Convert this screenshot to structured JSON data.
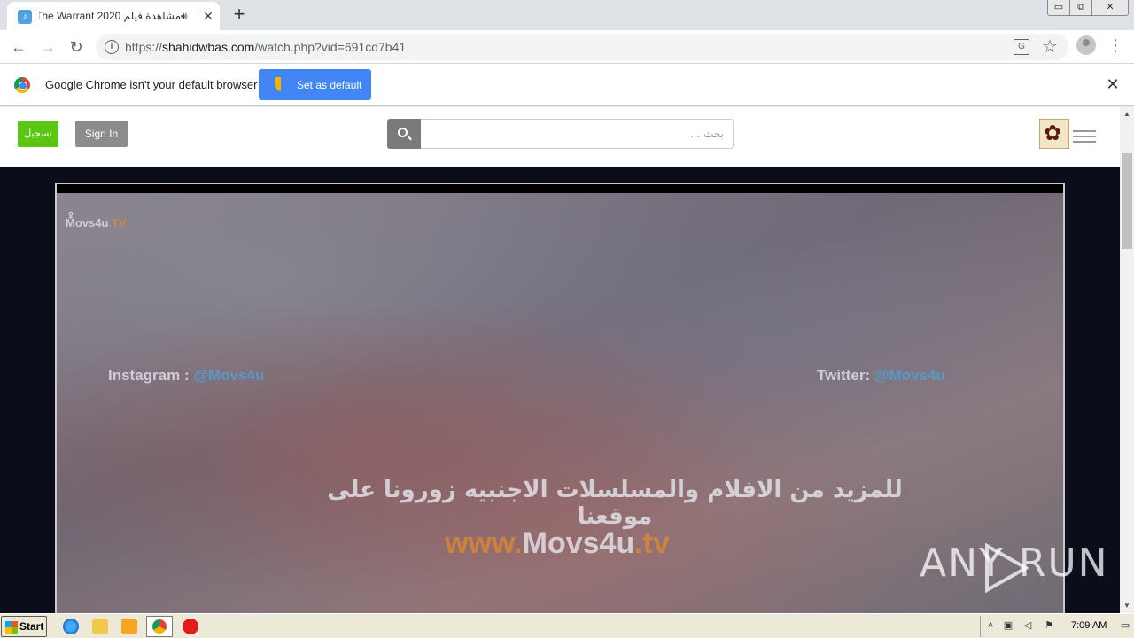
{
  "browser": {
    "tab": {
      "title": "مشاهدة فيلم The Warrant 2020",
      "close": "✕"
    },
    "new_tab": "+",
    "window": {
      "minimize": "▭",
      "maximize": "⧉",
      "close": "✕"
    },
    "url": {
      "scheme": "https://",
      "host": "shahidwbas.com",
      "path": "/watch.php?vid=691cd7b41"
    }
  },
  "infobar": {
    "message": "Google Chrome isn't your default browser",
    "button": "Set as default",
    "close": "✕"
  },
  "header": {
    "register": "تسجيل",
    "signin": "Sign In",
    "search_placeholder": "بحث ..."
  },
  "video": {
    "watermark_top": {
      "text": "Movs4u",
      "accent": ".TV"
    },
    "social_left": {
      "label": "Instagram : ",
      "handle": "@Movs4u"
    },
    "social_right": {
      "label": "Twitter: ",
      "handle": "@Movs4u_"
    },
    "subtitle_arabic": "للمزيد من الافلام والمسلسلات الاجنبيه زورونا على موقعنا",
    "subtitle_site": {
      "accent": "www.",
      "text": "Movs4u",
      "suffix": ".tv"
    }
  },
  "watermark": "ANY RUN",
  "taskbar": {
    "start": "Start",
    "clock": "7:09 AM"
  }
}
